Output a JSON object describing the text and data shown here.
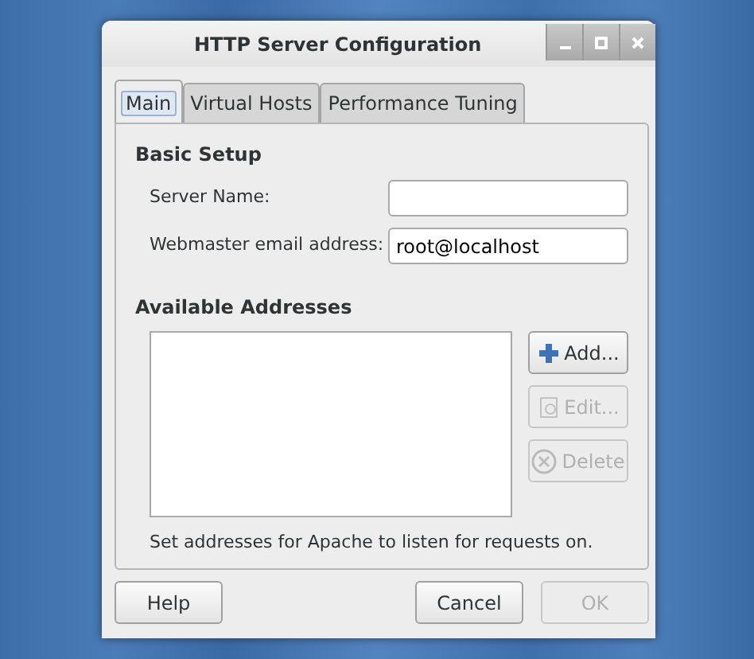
{
  "window": {
    "title": "HTTP Server Configuration"
  },
  "tabs": [
    {
      "label": "Main",
      "selected": true
    },
    {
      "label": "Virtual Hosts",
      "selected": false
    },
    {
      "label": "Performance Tuning",
      "selected": false
    }
  ],
  "basic_setup": {
    "heading": "Basic Setup",
    "fields": [
      {
        "label": "Server Name:"
      },
      {
        "label": "Webmaster email address:",
        "value": "root@localhost"
      }
    ]
  },
  "addresses": {
    "heading": "Available Addresses",
    "buttons": [
      {
        "label": "Add...",
        "kind": "add",
        "disabled": false
      },
      {
        "label": "Edit...",
        "kind": "edit",
        "disabled": true
      },
      {
        "label": "Delete",
        "kind": "delete",
        "disabled": true
      }
    ],
    "hint": "Set addresses for Apache to listen for requests on."
  },
  "footer_buttons": [
    {
      "label": "Help",
      "disabled": false
    },
    {
      "label": "Cancel",
      "disabled": false
    },
    {
      "label": "OK",
      "disabled": true
    }
  ]
}
